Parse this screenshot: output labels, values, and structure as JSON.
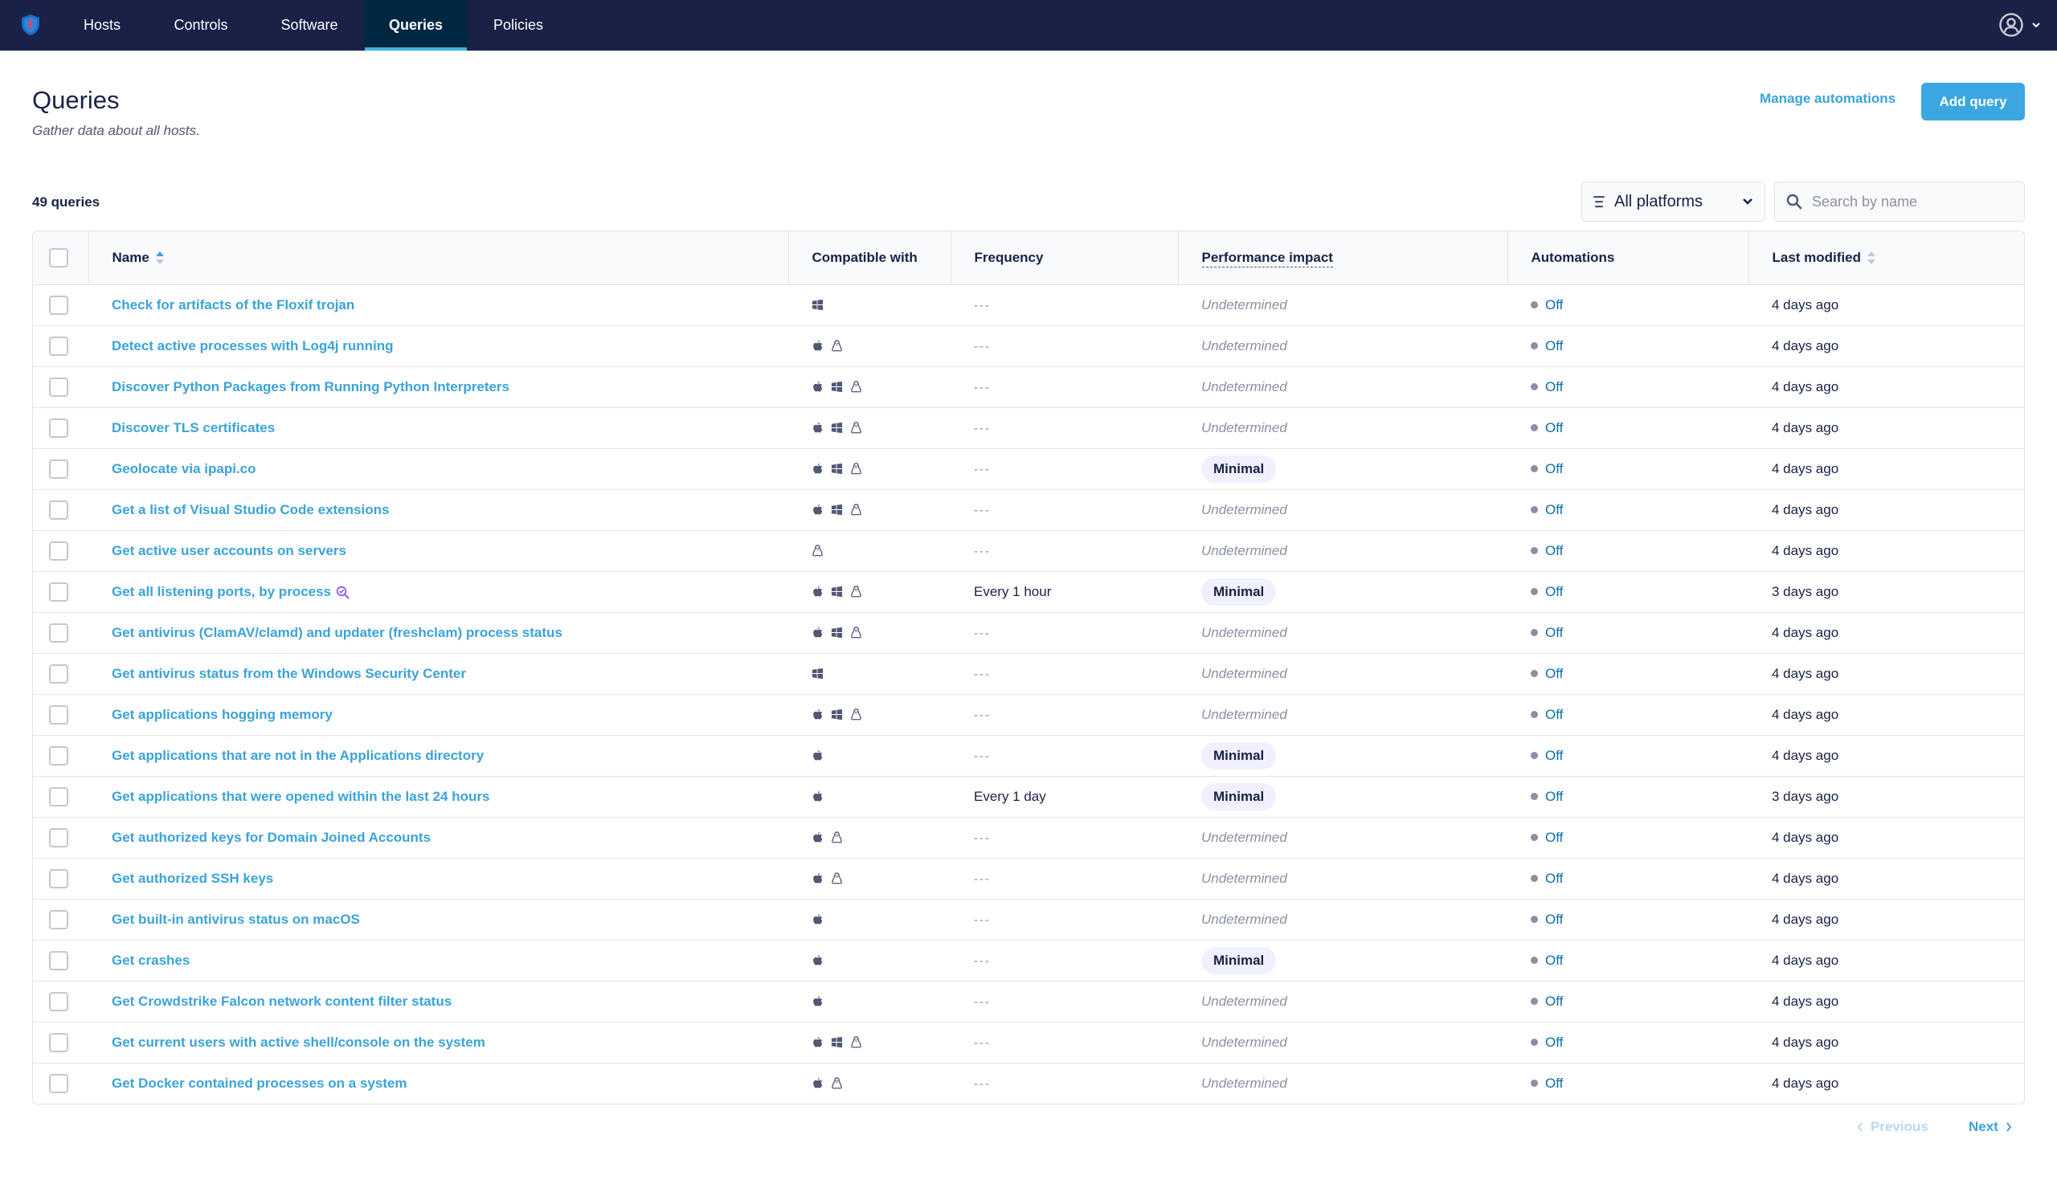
{
  "nav": {
    "items": [
      {
        "label": "Hosts",
        "active": false
      },
      {
        "label": "Controls",
        "active": false
      },
      {
        "label": "Software",
        "active": false
      },
      {
        "label": "Queries",
        "active": true
      },
      {
        "label": "Policies",
        "active": false
      }
    ],
    "logo_icon": "shield-logo-icon",
    "user_icon": "user-avatar-icon",
    "user_menu_icon": "chevron-down-icon"
  },
  "header": {
    "title": "Queries",
    "subtitle": "Gather data about all hosts.",
    "manage_automations": "Manage automations",
    "add_query": "Add query"
  },
  "toolbar": {
    "count": "49 queries",
    "platform_filter": "All platforms",
    "search_placeholder": "Search by name",
    "search_value": ""
  },
  "table": {
    "columns": {
      "name": "Name",
      "compatible": "Compatible with",
      "frequency": "Frequency",
      "performance": "Performance impact",
      "automations": "Automations",
      "modified": "Last modified"
    },
    "rows": [
      {
        "name": "Check for artifacts of the Floxif trojan",
        "platforms": [
          "windows"
        ],
        "frequency": "---",
        "performance": "Undetermined",
        "automations": "Off",
        "modified": "4 days ago"
      },
      {
        "name": "Detect active processes with Log4j running",
        "platforms": [
          "macos",
          "linux"
        ],
        "frequency": "---",
        "performance": "Undetermined",
        "automations": "Off",
        "modified": "4 days ago"
      },
      {
        "name": "Discover Python Packages from Running Python Interpreters",
        "platforms": [
          "macos",
          "windows",
          "linux"
        ],
        "frequency": "---",
        "performance": "Undetermined",
        "automations": "Off",
        "modified": "4 days ago"
      },
      {
        "name": "Discover TLS certificates",
        "platforms": [
          "macos",
          "windows",
          "linux"
        ],
        "frequency": "---",
        "performance": "Undetermined",
        "automations": "Off",
        "modified": "4 days ago"
      },
      {
        "name": "Geolocate via ipapi.co",
        "platforms": [
          "macos",
          "windows",
          "linux"
        ],
        "frequency": "---",
        "performance": "Minimal",
        "automations": "Off",
        "modified": "4 days ago"
      },
      {
        "name": "Get a list of Visual Studio Code extensions",
        "platforms": [
          "macos",
          "windows",
          "linux"
        ],
        "frequency": "---",
        "performance": "Undetermined",
        "automations": "Off",
        "modified": "4 days ago"
      },
      {
        "name": "Get active user accounts on servers",
        "platforms": [
          "linux"
        ],
        "frequency": "---",
        "performance": "Undetermined",
        "automations": "Off",
        "modified": "4 days ago"
      },
      {
        "name": "Get all listening ports, by process",
        "observer_can_run": true,
        "platforms": [
          "macos",
          "windows",
          "linux"
        ],
        "frequency": "Every 1 hour",
        "performance": "Minimal",
        "automations": "Off",
        "modified": "3 days ago"
      },
      {
        "name": "Get antivirus (ClamAV/clamd) and updater (freshclam) process status",
        "platforms": [
          "macos",
          "windows",
          "linux"
        ],
        "frequency": "---",
        "performance": "Undetermined",
        "automations": "Off",
        "modified": "4 days ago"
      },
      {
        "name": "Get antivirus status from the Windows Security Center",
        "platforms": [
          "windows"
        ],
        "frequency": "---",
        "performance": "Undetermined",
        "automations": "Off",
        "modified": "4 days ago"
      },
      {
        "name": "Get applications hogging memory",
        "platforms": [
          "macos",
          "windows",
          "linux"
        ],
        "frequency": "---",
        "performance": "Undetermined",
        "automations": "Off",
        "modified": "4 days ago"
      },
      {
        "name": "Get applications that are not in the Applications directory",
        "platforms": [
          "macos"
        ],
        "frequency": "---",
        "performance": "Minimal",
        "automations": "Off",
        "modified": "4 days ago"
      },
      {
        "name": "Get applications that were opened within the last 24 hours",
        "platforms": [
          "macos"
        ],
        "frequency": "Every 1 day",
        "performance": "Minimal",
        "automations": "Off",
        "modified": "3 days ago"
      },
      {
        "name": "Get authorized keys for Domain Joined Accounts",
        "platforms": [
          "macos",
          "linux"
        ],
        "frequency": "---",
        "performance": "Undetermined",
        "automations": "Off",
        "modified": "4 days ago"
      },
      {
        "name": "Get authorized SSH keys",
        "platforms": [
          "macos",
          "linux"
        ],
        "frequency": "---",
        "performance": "Undetermined",
        "automations": "Off",
        "modified": "4 days ago"
      },
      {
        "name": "Get built-in antivirus status on macOS",
        "platforms": [
          "macos"
        ],
        "frequency": "---",
        "performance": "Undetermined",
        "automations": "Off",
        "modified": "4 days ago"
      },
      {
        "name": "Get crashes",
        "platforms": [
          "macos"
        ],
        "frequency": "---",
        "performance": "Minimal",
        "automations": "Off",
        "modified": "4 days ago"
      },
      {
        "name": "Get Crowdstrike Falcon network content filter status",
        "platforms": [
          "macos"
        ],
        "frequency": "---",
        "performance": "Undetermined",
        "automations": "Off",
        "modified": "4 days ago"
      },
      {
        "name": "Get current users with active shell/console on the system",
        "platforms": [
          "macos",
          "windows",
          "linux"
        ],
        "frequency": "---",
        "performance": "Undetermined",
        "automations": "Off",
        "modified": "4 days ago"
      },
      {
        "name": "Get Docker contained processes on a system",
        "platforms": [
          "macos",
          "linux"
        ],
        "frequency": "---",
        "performance": "Undetermined",
        "automations": "Off",
        "modified": "4 days ago"
      }
    ]
  },
  "pagination": {
    "previous": "Previous",
    "next": "Next",
    "previous_enabled": false,
    "next_enabled": true
  },
  "colors": {
    "nav_bg": "#192147",
    "nav_active_bg": "#002742",
    "accent": "#3ba3d9",
    "primary_button": "#3ba7e0",
    "minimal_badge_bg": "#f1f0ff",
    "off_link": "#0a6ea7"
  }
}
